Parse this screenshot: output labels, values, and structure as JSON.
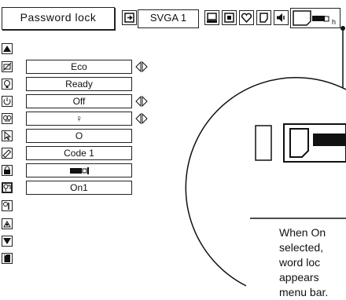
{
  "menubar": {
    "title": "Password lock",
    "signal": "SVGA 1",
    "icons": [
      "input-icon",
      "pc-adjust-icon",
      "image-icon",
      "color-icon",
      "sound-icon",
      "setting-icon"
    ]
  },
  "settings": [
    {
      "icon": "lamp-off-icon",
      "value": "Eco",
      "has_arrows": true
    },
    {
      "icon": "bulb-icon",
      "value": "Ready",
      "has_arrows": false
    },
    {
      "icon": "power-on-icon",
      "value": "Off",
      "has_arrows": true
    },
    {
      "icon": "lamp-mode-icon",
      "value": "♀",
      "has_arrows": true
    },
    {
      "icon": "pointer-icon",
      "value": "O",
      "has_arrows": false
    },
    {
      "icon": "remote-icon",
      "value": "Code 1",
      "has_arrows": false
    },
    {
      "icon": "lock-icon",
      "value": "▬▐",
      "has_arrows": false
    },
    {
      "icon": "pin-icon",
      "value": "On1",
      "has_arrows": false
    }
  ],
  "callout": {
    "lines": [
      "When On",
      "selected,",
      "word loc",
      "appears",
      "menu bar."
    ]
  }
}
